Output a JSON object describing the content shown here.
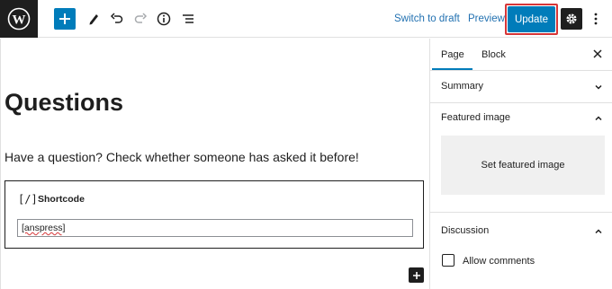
{
  "toolbar": {
    "switch_to_draft": "Switch to draft",
    "preview": "Preview",
    "update": "Update"
  },
  "editor": {
    "title": "Questions",
    "paragraph": "Have a question? Check whether someone has asked it before!",
    "shortcode_block": {
      "icon_glyph": "[/]",
      "label": "Shortcode",
      "value": "[anspress]"
    }
  },
  "sidebar": {
    "tabs": [
      {
        "label": "Page",
        "active": true
      },
      {
        "label": "Block",
        "active": false
      }
    ],
    "panels": {
      "summary": {
        "title": "Summary",
        "expanded": false
      },
      "featured_image": {
        "title": "Featured image",
        "expanded": true,
        "button": "Set featured image"
      },
      "discussion": {
        "title": "Discussion",
        "expanded": true,
        "allow_comments_label": "Allow comments",
        "allow_comments_checked": false
      }
    }
  },
  "colors": {
    "accent": "#007cba",
    "highlight_outline": "#d63638",
    "dark": "#1e1e1e",
    "link": "#2271b1"
  },
  "icons": [
    "wordpress-logo-icon",
    "plus-icon",
    "pencil-icon",
    "undo-icon",
    "redo-icon",
    "info-icon",
    "list-view-icon",
    "gear-icon",
    "more-vertical-icon",
    "close-icon",
    "chevron-down-icon",
    "chevron-up-icon"
  ]
}
